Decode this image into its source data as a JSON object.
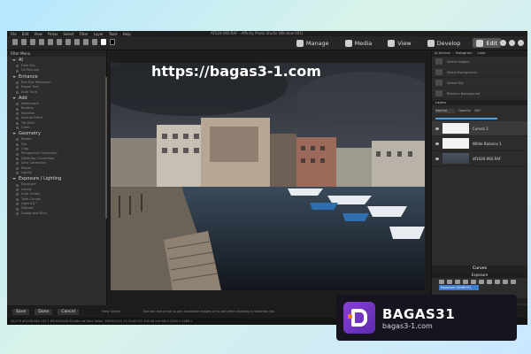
{
  "window": {
    "title": "AT026-060.RAF - Affinity Photo Studio (Window 001)",
    "menu": [
      "File",
      "Edit",
      "View",
      "Palias",
      "Select",
      "Filter",
      "Layer",
      "Tools",
      "Help"
    ]
  },
  "personas": [
    {
      "label": "Manage",
      "icon": "folder-icon"
    },
    {
      "label": "Media",
      "icon": "media-icon"
    },
    {
      "label": "View",
      "icon": "eye-icon"
    },
    {
      "label": "Develop",
      "icon": "develop-icon"
    },
    {
      "label": "Edit",
      "icon": "brush-icon",
      "active": true
    }
  ],
  "left_panel": {
    "title": "Filter Menu",
    "sections": [
      {
        "label": "AI",
        "items": [
          "Fake Sky",
          "Fix Pictures"
        ]
      },
      {
        "label": "Enhance",
        "items": [
          "Red Eye Reduction",
          "Repair Tool",
          "Auto Tune"
        ]
      },
      {
        "label": "Add",
        "items": [
          "Watermark",
          "Borders",
          "Vignette",
          "Special Effect",
          "Tilt-Shift",
          "Grain"
        ]
      },
      {
        "label": "Geometry",
        "items": [
          "Rotate",
          "Flip",
          "Crop",
          "Perspective Correction",
          "Distortion Correction",
          "Lens Correction",
          "Resize",
          "Liquify"
        ]
      },
      {
        "label": "Exposure / Lighting",
        "items": [
          "Exposure",
          "Levels",
          "Auto Levels",
          "Tone Curves",
          "Light EQ™",
          "Dehaze",
          "Dodge and Burn"
        ]
      }
    ],
    "footer": "Adjust Curves"
  },
  "watermark": "https://bagas3-1.com",
  "right_panel": {
    "tabs": [
      "AI Actions",
      "Histogram",
      "Color"
    ],
    "actions": [
      "Select Subject",
      "Select Background",
      "Select Sky",
      "Remove Background"
    ],
    "layers_title": "Layers",
    "blend_mode": "Normal",
    "opacity_label": "Opacity",
    "opacity_value": "100",
    "layers": [
      {
        "name": "Curves 1",
        "thumb": "white",
        "selected": true
      },
      {
        "name": "White Balance 1",
        "thumb": "white",
        "selected": false
      },
      {
        "name": "df1036-060.RAF",
        "thumb": "photo",
        "selected": false
      }
    ],
    "curves_label": "Curves",
    "exposure_label": "Exposure",
    "exposure_selected": "Exposure (Shift+E)",
    "info_title": "Info Palette",
    "info_lines": [
      "GFX50S II",
      "GF35-70mmF4.5-5.6 WR"
    ]
  },
  "status": {
    "save": "Save",
    "done": "Done",
    "cancel": "Cancel",
    "view_saved": "View Saved",
    "hint": "Use the Hand tool to pan scrollable images or to set other drawing in selection list.",
    "bottom": "20/179   df1036-060   135.1 MB   8256x6192x48b raf   Date Taken: 26/09/2021 17:25:09   ISO 100   28 mm   f/8.0   1/250 s   1280 x"
  },
  "badge": {
    "name": "BAGAS31",
    "url": "bagas3-1.com"
  }
}
